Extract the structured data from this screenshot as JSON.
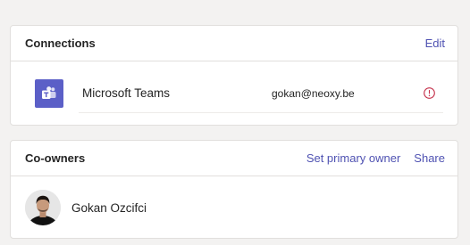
{
  "connections": {
    "title": "Connections",
    "edit_label": "Edit",
    "items": [
      {
        "name": "Microsoft Teams",
        "email": "gokan@neoxy.be",
        "icon": "microsoft-teams-icon",
        "status_icon": "warning-circle-icon",
        "status_color": "#c4314b"
      }
    ]
  },
  "coowners": {
    "title": "Co-owners",
    "set_primary_label": "Set primary owner",
    "share_label": "Share",
    "owners": [
      {
        "name": "Gokan Ozcifci",
        "icon": "avatar"
      }
    ]
  },
  "colors": {
    "accent": "#4f52b2",
    "teams": "#5b5fc7",
    "warning": "#c4314b"
  }
}
